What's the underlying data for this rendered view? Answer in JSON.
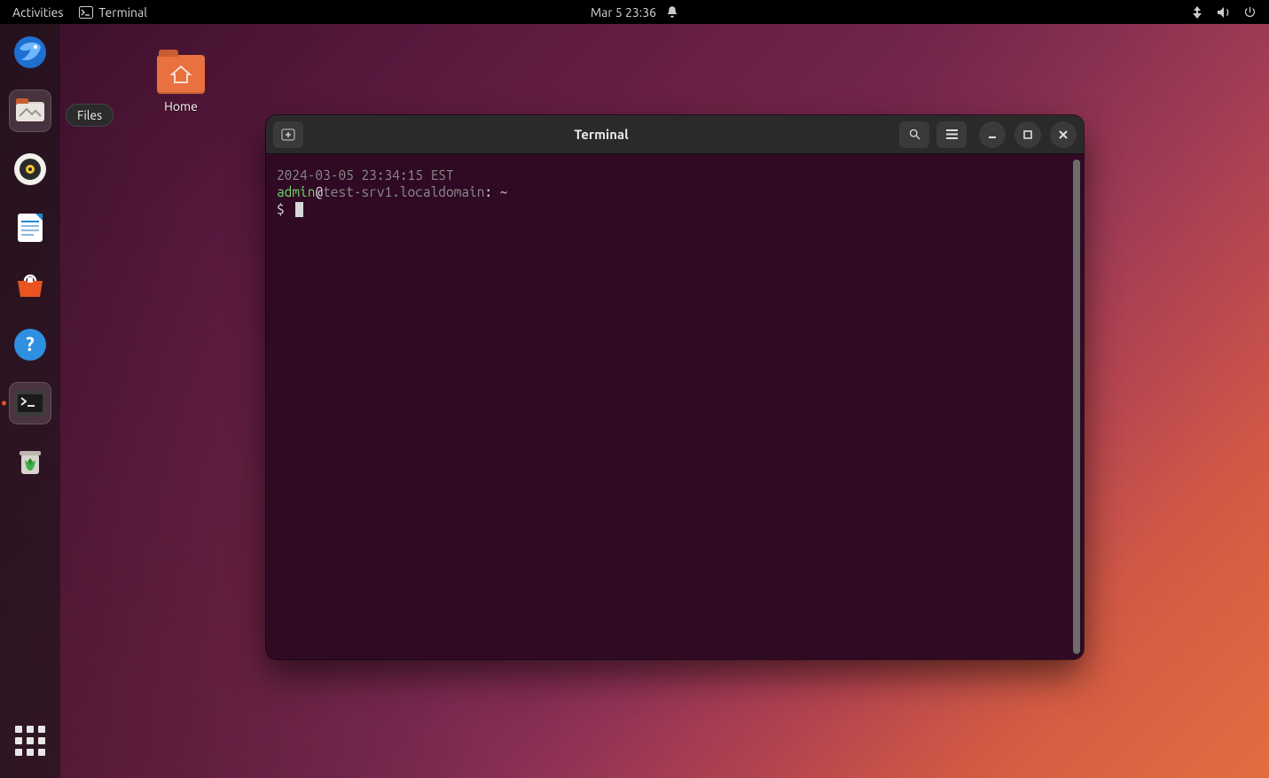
{
  "topbar": {
    "activities": "Activities",
    "app_name": "Terminal",
    "datetime": "Mar 5  23:36"
  },
  "dock": {
    "items": [
      {
        "name": "thunderbird",
        "tooltip": "Thunderbird"
      },
      {
        "name": "files",
        "tooltip": "Files"
      },
      {
        "name": "rhythmbox",
        "tooltip": "Rhythmbox"
      },
      {
        "name": "libreoffice-writer",
        "tooltip": "LibreOffice Writer"
      },
      {
        "name": "software",
        "tooltip": "Ubuntu Software"
      },
      {
        "name": "help",
        "tooltip": "Help"
      },
      {
        "name": "terminal",
        "tooltip": "Terminal"
      },
      {
        "name": "trash",
        "tooltip": "Trash"
      }
    ],
    "active_tooltip": "Files"
  },
  "desktop": {
    "home_label": "Home"
  },
  "window": {
    "title": "Terminal"
  },
  "terminal": {
    "timestamp": "2024-03-05 23:34:15 EST",
    "user": "admin",
    "at": "@",
    "host": "test-srv1.localdomain",
    "sep": ": ",
    "cwd": "~",
    "prompt": "$ "
  }
}
